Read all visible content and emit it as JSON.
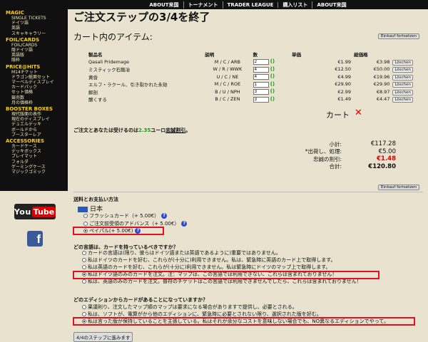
{
  "topnav": [
    "ABOUT来国",
    "トーナメント",
    "TRADER LEAGUE",
    "購入リスト",
    "ABOUT来国"
  ],
  "sidebar": [
    {
      "head": "MAGIC",
      "items": [
        "SINGLE TICKETS",
        "ドイツ語",
        "英語",
        "スキャキャラリー"
      ]
    },
    {
      "head": "FOIL/CARDS",
      "items": [
        "FOIL/CARDS",
        "隠ドイツ語",
        "英語版",
        "隠枠"
      ]
    },
    {
      "head": "PRICE@HITS",
      "items": [
        "M14チケット",
        "ドラゴン紙面セット",
        "マーベルディスプレイ",
        "カードパック",
        "セット価格",
        "競売数",
        "月の価格枠"
      ]
    },
    {
      "head": "BOOSTER BOXES",
      "items": [
        "現代版面の表作",
        "現在のディスプレイ",
        "デュエルデッキ",
        "ボールドから",
        "ブースターレア"
      ]
    },
    {
      "head": "ACCESSORIES",
      "items": [
        "カードケース",
        "デッキボックス",
        "プレイマット",
        "フォルダ",
        "ゲーミングケース",
        "マジックゴミック"
      ]
    }
  ],
  "social": {
    "youtube_a": "You",
    "youtube_b": "Tube",
    "facebook": "f"
  },
  "page": {
    "title": "ご注文ステップの3/4を終了",
    "cart_heading": "カート内のアイテム:",
    "continue_btn": "Einkauf fortsetzen"
  },
  "cart": {
    "headers": [
      "製品名",
      "説明",
      "数",
      "単価",
      "総価格"
    ],
    "rows": [
      {
        "name": "Qasali Pridemage",
        "desc": "M / C / ARB",
        "qty": "2",
        "unit": "€1.99",
        "total": "€3.98"
      },
      {
        "name": "ミスティック石鍛冶",
        "desc": "W / R / WWK",
        "qty": "4",
        "unit": "€12.50",
        "total": "€50.00"
      },
      {
        "name": "黄昏",
        "desc": "U / C / NE",
        "qty": "4",
        "unit": "€4.99",
        "total": "€19.96"
      },
      {
        "name": "エルフ・ラクール、引き裂かれた永劫",
        "desc": "M / C / ROE",
        "qty": "1",
        "unit": "€29.90",
        "total": "€29.90"
      },
      {
        "name": "解剖",
        "desc": "B / U / NPH",
        "qty": "3",
        "unit": "€2.99",
        "total": "€8.97"
      },
      {
        "name": "醸くする",
        "desc": "B / C / ZEN",
        "qty": "3",
        "unit": "€1.49",
        "total": "€4.47"
      }
    ],
    "check": "()",
    "delete_label": "Löschen",
    "kart_label": "カート",
    "x_icon": "✕"
  },
  "points": {
    "pre": "ご注文とあなたは受けるのは",
    "value": "2.35",
    "mid": "ユーロ",
    "link": "忠誠割引",
    "post": "。"
  },
  "summary": [
    {
      "label": "小計:",
      "value": "€117.28",
      "style": ""
    },
    {
      "label": "*出荷し、処理:",
      "value": "€5.00",
      "style": ""
    },
    {
      "label": "忠誠の割引:",
      "value": "€1.48",
      "style": "red"
    },
    {
      "label": "合計:",
      "value": "€120.80",
      "style": "bold"
    }
  ],
  "shipping": {
    "title": "送料とお支払い方法",
    "country": "日本",
    "options": [
      {
        "label": "フラッシュカード（+ 5.00€）",
        "selected": false
      },
      {
        "label": "ご注文前受領のアドバンス（+ 5.00€）",
        "selected": false
      },
      {
        "label": "ペイパル(+ 5.00€)",
        "selected": true
      }
    ]
  },
  "language": {
    "title": "どの言語は、カードを持っているべきですか？",
    "options": [
      {
        "label": "カードの言語は(限り、彼らはドイツ語または英語であるように)重要ではありません。",
        "selected": false
      },
      {
        "label": "私はドイツのカードを好む、これらが(十分に)利用できません。私は、緊急時に英語のカード上で取得します。",
        "selected": false
      },
      {
        "label": "私は英語のカードを好む、これらが(十分に)利用できません。私は緊急時にドイツのマップ上で取得します。",
        "selected": false
      },
      {
        "label": "私はドイツ語のみのカードを注文。注：マップは、この言語では利用できない、これらは含まれておりません！",
        "selected": true
      },
      {
        "label": "私は、英語のみのカードを注文。普符のチケットはこの言語では利用できませんでしたら、これらは含まれておりません！",
        "selected": false
      }
    ]
  },
  "edition": {
    "title": "どのエディションからカードがあることになっていますか？",
    "options": [
      {
        "label": "果議則り、注文したマップ順のマップは要求になる場合がありますで提供し、必要とされる。",
        "selected": false
      },
      {
        "label": "私は、ソフトが、電算がから他のエディションに、緊急時に必要とされない限り、選択された版を好む。",
        "selected": false
      },
      {
        "label": "私は言った版が保持していることを主張している。私はそれが余分なコストを意味しない場合でも、NO異なるエディションでやって。",
        "selected": true
      }
    ]
  },
  "next_button": "4/4のステップに進みます"
}
